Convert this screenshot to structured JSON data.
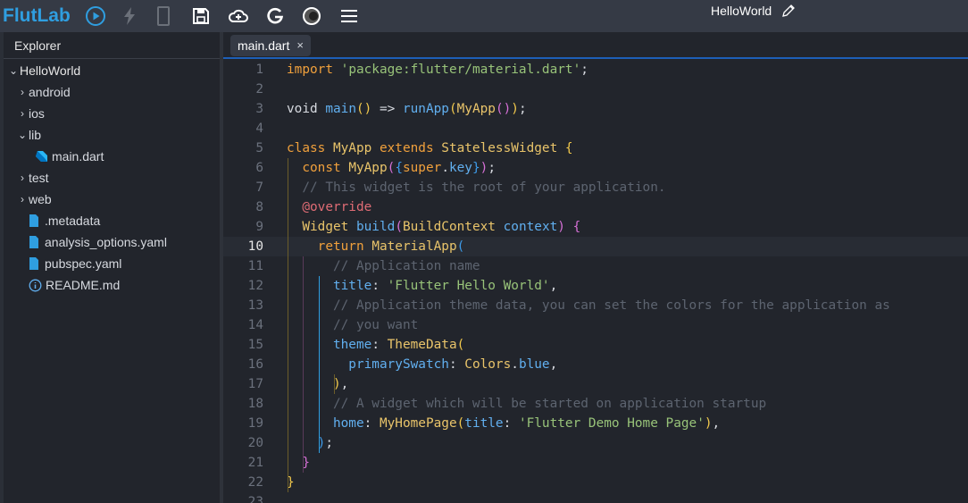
{
  "app": {
    "logo": "FlutLab",
    "project_name": "HelloWorld"
  },
  "toolbar": [
    {
      "name": "run-icon",
      "glyph": "play"
    },
    {
      "name": "hot-reload-icon",
      "glyph": "bolt"
    },
    {
      "name": "device-icon",
      "glyph": "phone"
    },
    {
      "name": "save-icon",
      "glyph": "save"
    },
    {
      "name": "cloud-upload-icon",
      "glyph": "cloud"
    },
    {
      "name": "google-icon",
      "glyph": "G"
    },
    {
      "name": "theme-icon",
      "glyph": "circle"
    },
    {
      "name": "menu-icon",
      "glyph": "menu"
    }
  ],
  "explorer": {
    "title": "Explorer",
    "items": [
      {
        "label": "HelloWorld",
        "type": "folder-open",
        "depth": 0
      },
      {
        "label": "android",
        "type": "folder",
        "depth": 1
      },
      {
        "label": "ios",
        "type": "folder",
        "depth": 1
      },
      {
        "label": "lib",
        "type": "folder-open",
        "depth": 1
      },
      {
        "label": "main.dart",
        "type": "dart",
        "depth": 2
      },
      {
        "label": "test",
        "type": "folder",
        "depth": 1
      },
      {
        "label": "web",
        "type": "folder",
        "depth": 1
      },
      {
        "label": ".metadata",
        "type": "file",
        "depth": 1
      },
      {
        "label": "analysis_options.yaml",
        "type": "file",
        "depth": 1
      },
      {
        "label": "pubspec.yaml",
        "type": "file",
        "depth": 1
      },
      {
        "label": "README.md",
        "type": "info",
        "depth": 1
      }
    ]
  },
  "tabs": [
    {
      "label": "main.dart",
      "close": "×"
    }
  ],
  "editor": {
    "active_line": 10,
    "lines": [
      [
        [
          "import ",
          "kw"
        ],
        [
          "'package:flutter/material.dart'",
          "str"
        ],
        [
          ";",
          "pl"
        ]
      ],
      [],
      [
        [
          "void ",
          "pl"
        ],
        [
          "main",
          "fn"
        ],
        [
          "()",
          "p1"
        ],
        [
          " => ",
          "pl"
        ],
        [
          "runApp",
          "fn"
        ],
        [
          "(",
          "p1"
        ],
        [
          "MyApp",
          "ty"
        ],
        [
          "()",
          "p2"
        ],
        [
          ")",
          "p1"
        ],
        [
          ";",
          "pl"
        ]
      ],
      [],
      [
        [
          "class ",
          "kw"
        ],
        [
          "MyApp ",
          "ty"
        ],
        [
          "extends ",
          "kw"
        ],
        [
          "StatelessWidget ",
          "ty"
        ],
        [
          "{",
          "p1"
        ]
      ],
      [
        [
          "  const ",
          "kw"
        ],
        [
          "MyApp",
          "ty"
        ],
        [
          "(",
          "p2"
        ],
        [
          "{",
          "p3"
        ],
        [
          "super",
          "kw"
        ],
        [
          ".",
          "pl"
        ],
        [
          "key",
          "pr"
        ],
        [
          "}",
          "p3"
        ],
        [
          ")",
          "p2"
        ],
        [
          ";",
          "pl"
        ]
      ],
      [
        [
          "  // This widget is the root of your application.",
          "cm"
        ]
      ],
      [
        [
          "  @override",
          "an"
        ]
      ],
      [
        [
          "  Widget ",
          "ty"
        ],
        [
          "build",
          "fn"
        ],
        [
          "(",
          "p2"
        ],
        [
          "BuildContext ",
          "ty"
        ],
        [
          "context",
          "pr"
        ],
        [
          ")",
          "p2"
        ],
        [
          " ",
          "pl"
        ],
        [
          "{",
          "p2"
        ]
      ],
      [
        [
          "    return ",
          "kw"
        ],
        [
          "MaterialApp",
          "ty"
        ],
        [
          "(",
          "p3"
        ]
      ],
      [
        [
          "      // Application name",
          "cm"
        ]
      ],
      [
        [
          "      title",
          "pr"
        ],
        [
          ": ",
          "pl"
        ],
        [
          "'Flutter Hello World'",
          "str"
        ],
        [
          ",",
          "pl"
        ]
      ],
      [
        [
          "      // Application theme data, you can set the colors for the application as",
          "cm"
        ]
      ],
      [
        [
          "      // you want",
          "cm"
        ]
      ],
      [
        [
          "      theme",
          "pr"
        ],
        [
          ": ",
          "pl"
        ],
        [
          "ThemeData",
          "ty"
        ],
        [
          "(",
          "p1"
        ]
      ],
      [
        [
          "        primarySwatch",
          "pr"
        ],
        [
          ": ",
          "pl"
        ],
        [
          "Colors",
          "ty"
        ],
        [
          ".",
          "pl"
        ],
        [
          "blue",
          "pr"
        ],
        [
          ",",
          "pl"
        ]
      ],
      [
        [
          "      ",
          "pl"
        ],
        [
          ")",
          "p1"
        ],
        [
          ",",
          "pl"
        ]
      ],
      [
        [
          "      // A widget which will be started on application startup",
          "cm"
        ]
      ],
      [
        [
          "      home",
          "pr"
        ],
        [
          ": ",
          "pl"
        ],
        [
          "MyHomePage",
          "ty"
        ],
        [
          "(",
          "p1"
        ],
        [
          "title",
          "pr"
        ],
        [
          ": ",
          "pl"
        ],
        [
          "'Flutter Demo Home Page'",
          "str"
        ],
        [
          ")",
          "p1"
        ],
        [
          ",",
          "pl"
        ]
      ],
      [
        [
          "    ",
          "pl"
        ],
        [
          ")",
          "p3"
        ],
        [
          ";",
          "pl"
        ]
      ],
      [
        [
          "  ",
          "pl"
        ],
        [
          "}",
          "p2"
        ]
      ],
      [
        [
          "}",
          "p1"
        ]
      ],
      []
    ]
  }
}
